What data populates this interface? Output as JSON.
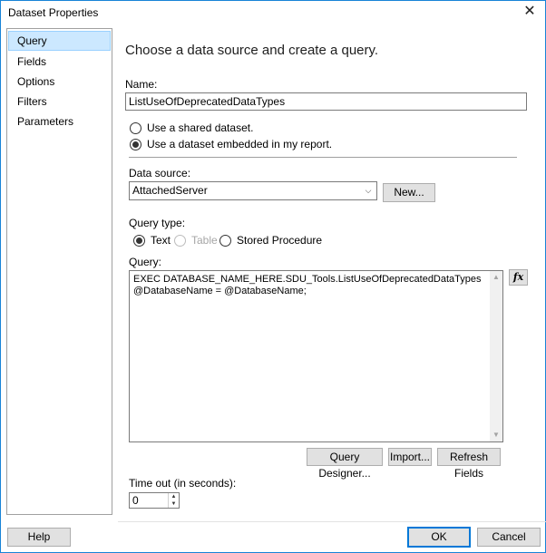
{
  "window": {
    "title": "Dataset Properties",
    "close_glyph": "✕"
  },
  "sidebar": {
    "items": [
      {
        "label": "Query",
        "selected": true
      },
      {
        "label": "Fields"
      },
      {
        "label": "Options"
      },
      {
        "label": "Filters"
      },
      {
        "label": "Parameters"
      }
    ]
  },
  "main": {
    "heading": "Choose a data source and create a query.",
    "name_label": "Name:",
    "name_value": "ListUseOfDeprecatedDataTypes",
    "radio_shared": "Use a shared dataset.",
    "radio_embedded": "Use a dataset embedded in my report.",
    "datasource_label": "Data source:",
    "datasource_value": "AttachedServer",
    "new_button": "New...",
    "query_type_label": "Query type:",
    "query_type_text": "Text",
    "query_type_table": "Table",
    "query_type_sp": "Stored Procedure",
    "query_label": "Query:",
    "query_text": "EXEC DATABASE_NAME_HERE.SDU_Tools.ListUseOfDeprecatedDataTypes\n@DatabaseName = @DatabaseName;",
    "fx_button": "fx",
    "query_designer_button": "Query Designer...",
    "import_button": "Import...",
    "refresh_fields_button": "Refresh Fields",
    "timeout_label": "Time out (in seconds):",
    "timeout_value": "0"
  },
  "footer": {
    "help_button": "Help",
    "ok_button": "OK",
    "cancel_button": "Cancel"
  },
  "colors": {
    "accent": "#0078d7",
    "selection": "#cce8ff",
    "window_border": "#1883d7"
  }
}
